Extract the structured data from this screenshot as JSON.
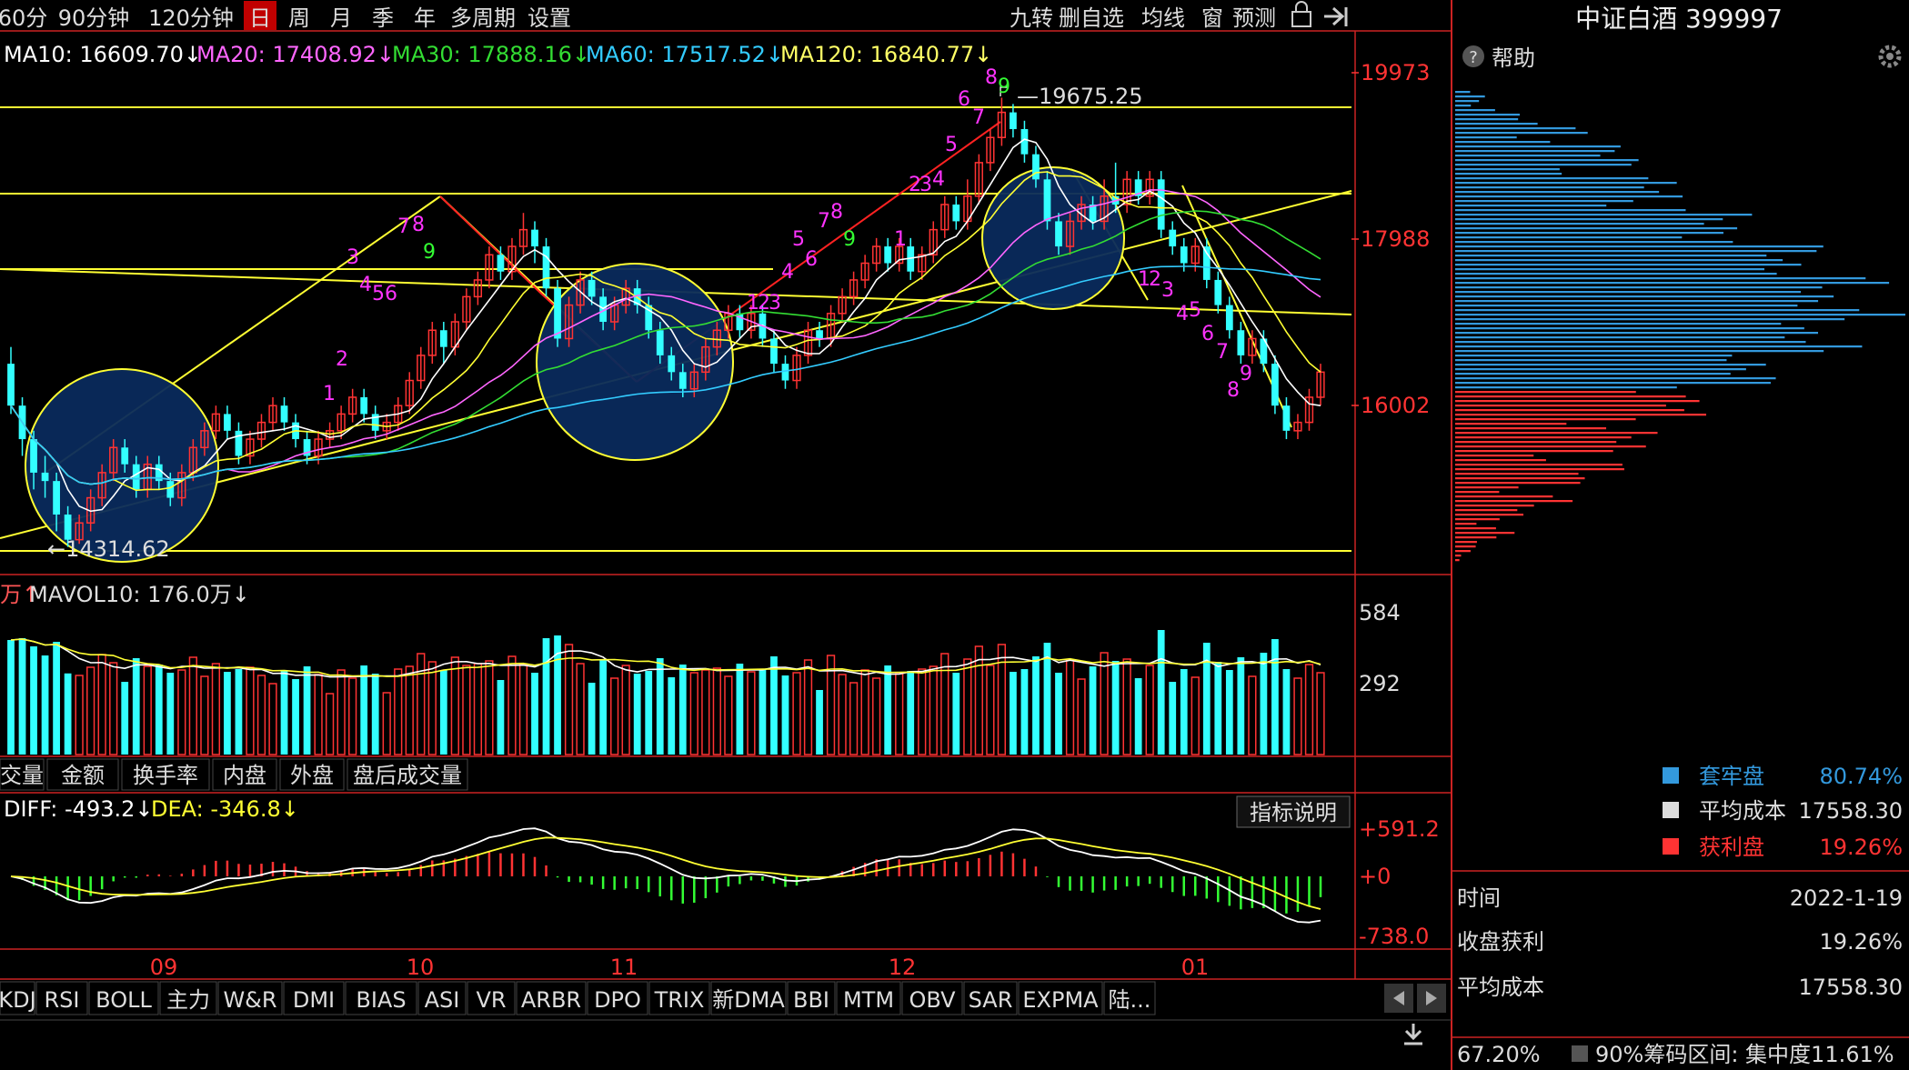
{
  "toolbar": {
    "periods": [
      "60分",
      "90分钟",
      "120分钟",
      "日",
      "周",
      "月",
      "季",
      "年",
      "多周期",
      "设置"
    ],
    "active_period": "日",
    "right_buttons": [
      "九转",
      "删自选",
      "均线",
      "窗",
      "预测"
    ]
  },
  "price_panel": {
    "ma_legend": [
      {
        "label": "MA10: 16609.70↓",
        "color": "#ffffff"
      },
      {
        "label": "MA20: 17408.92↓",
        "color": "#ff66ff"
      },
      {
        "label": "MA30: 17888.16↓",
        "color": "#33dd33"
      },
      {
        "label": "MA60: 17517.52↓",
        "color": "#33ccff"
      },
      {
        "label": "MA120: 16840.77↓",
        "color": "#ffff66"
      }
    ],
    "high_label": "19675.25",
    "low_label": "14314.62",
    "axis_ticks": [
      "19973",
      "17988",
      "16002"
    ]
  },
  "volume_panel": {
    "legend_prefix": "万↑",
    "legend": "MAVOL10: 176.0万↓",
    "axis_ticks": [
      "584",
      "292"
    ]
  },
  "sub_tabs": [
    "交量",
    "金额",
    "换手率",
    "内盘",
    "外盘",
    "盘后成交量"
  ],
  "macd_panel": {
    "diff": "DIFF: -493.2↓",
    "dea": "DEA: -346.8↓",
    "button": "指标说明",
    "axis_ticks": [
      "+591.2",
      "+0",
      "-738.0"
    ]
  },
  "x_axis": [
    "09",
    "10",
    "11",
    "12",
    "01"
  ],
  "indicator_tabs": [
    "KDJ",
    "RSI",
    "BOLL",
    "主力",
    "W&R",
    "DMI",
    "BIAS",
    "ASI",
    "VR",
    "ARBR",
    "DPO",
    "TRIX",
    "新DMA",
    "BBI",
    "MTM",
    "OBV",
    "SAR",
    "EXPMA",
    "陆..."
  ],
  "right_panel": {
    "title": "中证白酒 399997",
    "help": "帮助",
    "legend": [
      {
        "label": "套牢盘",
        "value": "80.74%",
        "color": "#3399dd"
      },
      {
        "label": "平均成本",
        "value": "17558.30",
        "color": "#dddddd"
      },
      {
        "label": "获利盘",
        "value": "19.26%",
        "color": "#ff3333"
      }
    ],
    "info": [
      {
        "label": "时间",
        "value": "2022-1-19"
      },
      {
        "label": "收盘获利",
        "value": "19.26%"
      },
      {
        "label": "平均成本",
        "value": "17558.30"
      }
    ],
    "footer_left": "67.20%",
    "footer_right": "90%筹码区间: 集中度11.61%"
  },
  "chart_data": {
    "type": "candlestick",
    "price_axis_ticks": [
      19973,
      17988,
      16002
    ],
    "candles": [
      [
        16500,
        16000,
        16700,
        15900
      ],
      [
        16000,
        15600,
        16100,
        15400
      ],
      [
        15600,
        15200,
        15700,
        15000
      ],
      [
        15200,
        15100,
        15400,
        14900
      ],
      [
        15100,
        14700,
        15200,
        14500
      ],
      [
        14700,
        14400,
        14800,
        14314.62
      ],
      [
        14400,
        14600,
        14700,
        14350
      ],
      [
        14600,
        14900,
        15000,
        14500
      ],
      [
        14900,
        15200,
        15300,
        14800
      ],
      [
        15200,
        15500,
        15600,
        15100
      ],
      [
        15500,
        15300,
        15600,
        15200
      ],
      [
        15300,
        15000,
        15400,
        14900
      ],
      [
        15000,
        15300,
        15400,
        14900
      ],
      [
        15300,
        15100,
        15400,
        15000
      ],
      [
        15100,
        14900,
        15200,
        14800
      ],
      [
        14900,
        15200,
        15300,
        14800
      ],
      [
        15200,
        15500,
        15600,
        15100
      ],
      [
        15500,
        15700,
        15800,
        15400
      ],
      [
        15700,
        15900,
        16000,
        15600
      ],
      [
        15900,
        15700,
        16000,
        15600
      ],
      [
        15700,
        15400,
        15800,
        15300
      ],
      [
        15400,
        15600,
        15700,
        15300
      ],
      [
        15600,
        15800,
        15900,
        15500
      ],
      [
        15800,
        16000,
        16100,
        15700
      ],
      [
        16000,
        15800,
        16100,
        15700
      ],
      [
        15800,
        15600,
        15900,
        15500
      ],
      [
        15600,
        15400,
        15700,
        15300
      ],
      [
        15400,
        15600,
        15700,
        15300
      ],
      [
        15600,
        15700,
        15800,
        15500
      ],
      [
        15700,
        15900,
        16000,
        15600
      ],
      [
        15900,
        16100,
        16200,
        15800
      ],
      [
        16100,
        15900,
        16200,
        15800
      ],
      [
        15900,
        15700,
        16000,
        15600
      ],
      [
        15700,
        15800,
        15900,
        15600
      ],
      [
        15800,
        16000,
        16100,
        15700
      ],
      [
        16000,
        16300,
        16400,
        15900
      ],
      [
        16300,
        16600,
        16700,
        16200
      ],
      [
        16600,
        16900,
        17000,
        16500
      ],
      [
        16900,
        16700,
        17000,
        16500
      ],
      [
        16700,
        17000,
        17100,
        16600
      ],
      [
        17000,
        17300,
        17400,
        16900
      ],
      [
        17300,
        17500,
        17600,
        17200
      ],
      [
        17500,
        17800,
        17900,
        17400
      ],
      [
        17800,
        17600,
        17900,
        17500
      ],
      [
        17600,
        17900,
        18000,
        17500
      ],
      [
        17900,
        18100,
        18300,
        17800
      ],
      [
        18100,
        17900,
        18200,
        17700
      ],
      [
        17900,
        17400,
        18000,
        17300
      ],
      [
        17400,
        16800,
        17500,
        16700
      ],
      [
        16800,
        17200,
        17300,
        16700
      ],
      [
        17200,
        17500,
        17600,
        17100
      ],
      [
        17500,
        17300,
        17600,
        17200
      ],
      [
        17300,
        17000,
        17400,
        16900
      ],
      [
        17000,
        17200,
        17300,
        16900
      ],
      [
        17200,
        17400,
        17500,
        17100
      ],
      [
        17400,
        17200,
        17500,
        17100
      ],
      [
        17200,
        16900,
        17300,
        16800
      ],
      [
        16900,
        16600,
        17000,
        16500
      ],
      [
        16600,
        16400,
        16700,
        16300
      ],
      [
        16400,
        16200,
        16500,
        16100
      ],
      [
        16200,
        16400,
        16500,
        16100
      ],
      [
        16400,
        16700,
        16800,
        16300
      ],
      [
        16700,
        16900,
        17000,
        16600
      ],
      [
        16900,
        17100,
        17200,
        16800
      ],
      [
        17100,
        16900,
        17200,
        16800
      ],
      [
        16900,
        17100,
        17200,
        16800
      ],
      [
        17100,
        16800,
        17200,
        16700
      ],
      [
        16800,
        16500,
        16900,
        16400
      ],
      [
        16500,
        16300,
        16600,
        16200
      ],
      [
        16300,
        16600,
        16700,
        16200
      ],
      [
        16600,
        16900,
        17000,
        16500
      ],
      [
        16900,
        16800,
        17000,
        16700
      ],
      [
        16800,
        17100,
        17200,
        16700
      ],
      [
        17100,
        17300,
        17400,
        17000
      ],
      [
        17300,
        17500,
        17600,
        17200
      ],
      [
        17500,
        17700,
        17800,
        17400
      ],
      [
        17700,
        17900,
        18000,
        17600
      ],
      [
        17900,
        17700,
        18000,
        17600
      ],
      [
        17700,
        17900,
        18000,
        17600
      ],
      [
        17900,
        17600,
        18000,
        17500
      ],
      [
        17600,
        17800,
        17900,
        17500
      ],
      [
        17800,
        18100,
        18200,
        17700
      ],
      [
        18100,
        18400,
        18500,
        18000
      ],
      [
        18400,
        18200,
        18500,
        18100
      ],
      [
        18200,
        18500,
        18700,
        18100
      ],
      [
        18500,
        18900,
        19000,
        18400
      ],
      [
        18900,
        19200,
        19300,
        18800
      ],
      [
        19200,
        19500,
        19675.25,
        19100
      ],
      [
        19500,
        19300,
        19600,
        19200
      ],
      [
        19300,
        19000,
        19400,
        18900
      ],
      [
        19000,
        18700,
        19100,
        18600
      ],
      [
        18700,
        18200,
        18800,
        18100
      ],
      [
        18200,
        17900,
        18300,
        17800
      ],
      [
        17900,
        18200,
        18300,
        17800
      ],
      [
        18200,
        18400,
        18500,
        18100
      ],
      [
        18400,
        18200,
        18500,
        18100
      ],
      [
        18200,
        18500,
        18700,
        18100
      ],
      [
        18500,
        18400,
        18900,
        18300
      ],
      [
        18400,
        18700,
        18800,
        18300
      ],
      [
        18700,
        18500,
        18800,
        18400
      ],
      [
        18500,
        18700,
        18800,
        18400
      ],
      [
        18700,
        18100,
        18800,
        18000
      ],
      [
        18100,
        17900,
        18200,
        17800
      ],
      [
        17900,
        17700,
        18000,
        17600
      ],
      [
        17700,
        17900,
        18000,
        17600
      ],
      [
        17900,
        17500,
        18000,
        17400
      ],
      [
        17500,
        17200,
        17600,
        17100
      ],
      [
        17200,
        16900,
        17300,
        16800
      ],
      [
        16900,
        16600,
        17000,
        16500
      ],
      [
        16600,
        16800,
        16900,
        16500
      ],
      [
        16800,
        16500,
        16900,
        16400
      ],
      [
        16500,
        16000,
        16600,
        15900
      ],
      [
        16000,
        15700,
        16100,
        15600
      ],
      [
        15700,
        15800,
        15900,
        15600
      ],
      [
        15800,
        16100,
        16200,
        15700
      ],
      [
        16100,
        16400,
        16500,
        16000
      ]
    ],
    "volume_axis_ticks": [
      584,
      292
    ]
  }
}
